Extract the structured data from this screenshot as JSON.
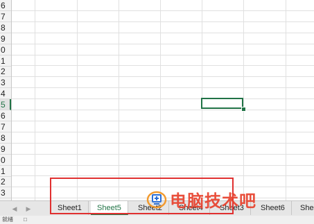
{
  "row_numbers": [
    "6",
    "7",
    "8",
    "9",
    "0",
    "1",
    "2",
    "3",
    "4",
    "5",
    "6",
    "7",
    "8",
    "9",
    "0",
    "1",
    "2",
    "3"
  ],
  "active_row_index": 9,
  "sheet_tabs": [
    "Sheet1",
    "Sheet5",
    "Sheet2",
    "Sheet4",
    "Sheet3",
    "Sheet6",
    "She"
  ],
  "active_tab": "Sheet5",
  "nav_icons": [
    "scroll-left-icon",
    "scroll-right-icon"
  ],
  "status_text": [
    "就绪",
    "□"
  ],
  "watermark": {
    "text": "电脑技术吧"
  },
  "colors": {
    "accent": "#217346",
    "highlight_box": "#e03030",
    "watermark": "#e8412c"
  }
}
